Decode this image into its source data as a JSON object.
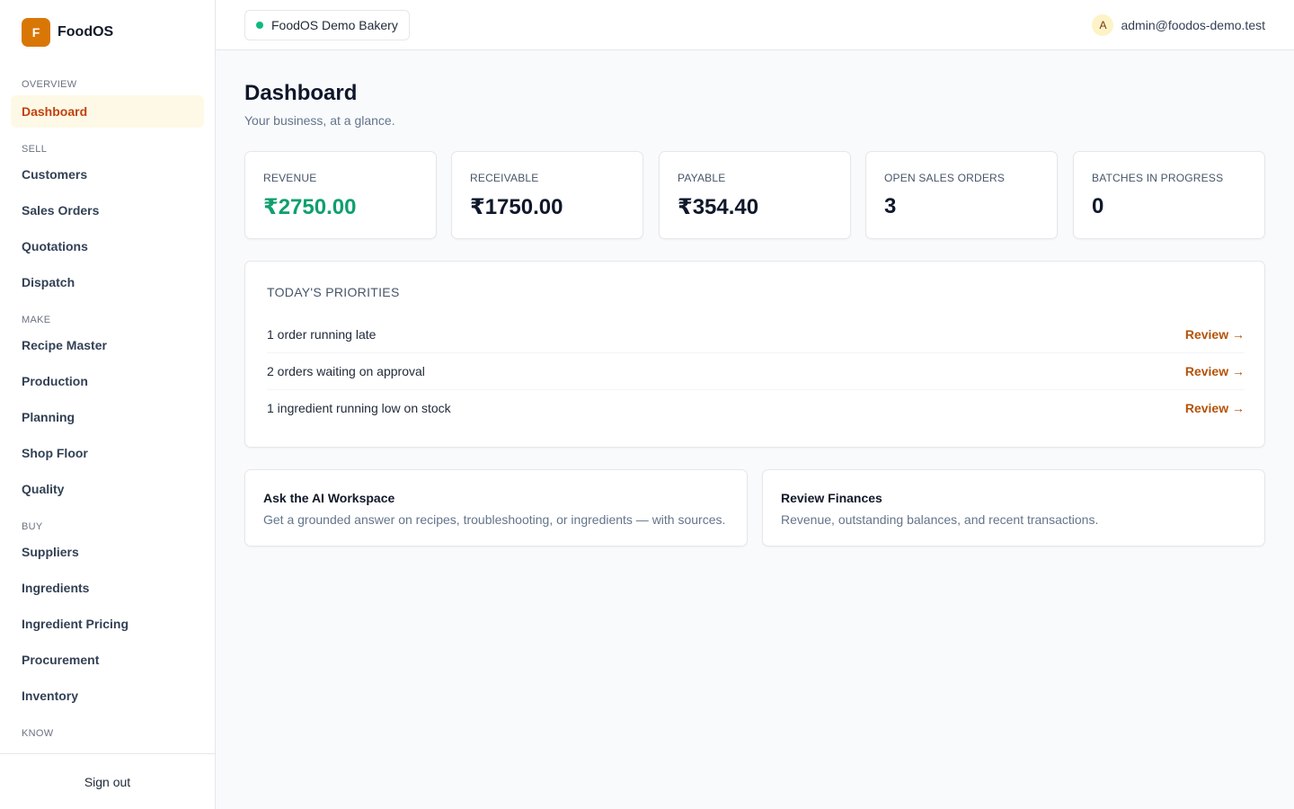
{
  "brand": {
    "logo_letter": "F",
    "name": "FoodOS",
    "accent_color": "#d97706"
  },
  "sidebar": {
    "sections": [
      {
        "title": "OVERVIEW",
        "items": [
          {
            "label": "Dashboard",
            "active": true
          }
        ]
      },
      {
        "title": "SELL",
        "items": [
          {
            "label": "Customers"
          },
          {
            "label": "Sales Orders"
          },
          {
            "label": "Quotations"
          },
          {
            "label": "Dispatch"
          }
        ]
      },
      {
        "title": "MAKE",
        "items": [
          {
            "label": "Recipe Master"
          },
          {
            "label": "Production"
          },
          {
            "label": "Planning"
          },
          {
            "label": "Shop Floor"
          },
          {
            "label": "Quality"
          }
        ]
      },
      {
        "title": "BUY",
        "items": [
          {
            "label": "Suppliers"
          },
          {
            "label": "Ingredients"
          },
          {
            "label": "Ingredient Pricing"
          },
          {
            "label": "Procurement"
          },
          {
            "label": "Inventory"
          }
        ]
      },
      {
        "title": "KNOW",
        "items": []
      }
    ],
    "sign_out_label": "Sign out"
  },
  "topbar": {
    "org_name": "FoodOS Demo Bakery",
    "org_status_color": "#10b981",
    "user_initial": "A",
    "user_email": "admin@foodos-demo.test"
  },
  "page": {
    "title": "Dashboard",
    "subtitle": "Your business, at a glance."
  },
  "stats": [
    {
      "label": "REVENUE",
      "value": "₹2750.00",
      "positive": true
    },
    {
      "label": "RECEIVABLE",
      "value": "₹1750.00"
    },
    {
      "label": "PAYABLE",
      "value": "₹354.40"
    },
    {
      "label": "OPEN SALES ORDERS",
      "value": "3"
    },
    {
      "label": "BATCHES IN PROGRESS",
      "value": "0"
    }
  ],
  "priorities": {
    "title": "TODAY'S PRIORITIES",
    "items": [
      {
        "text": "1 order running late",
        "action": "Review →"
      },
      {
        "text": "2 orders waiting on approval",
        "action": "Review →"
      },
      {
        "text": "1 ingredient running low on stock",
        "action": "Review →"
      }
    ]
  },
  "actions": [
    {
      "title": "Ask the AI Workspace",
      "description": "Get a grounded answer on recipes, troubleshooting, or ingredients — with sources."
    },
    {
      "title": "Review Finances",
      "description": "Revenue, outstanding balances, and recent transactions."
    }
  ]
}
